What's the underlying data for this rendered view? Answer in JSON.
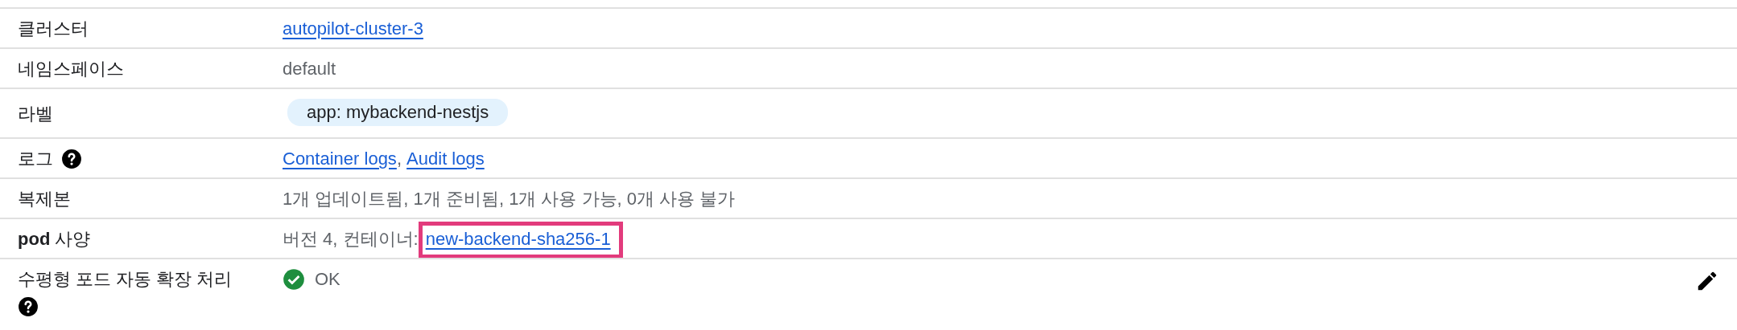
{
  "rows": [
    {
      "label": "클러스터",
      "help": false,
      "editable": false,
      "parts": [
        {
          "kind": "link",
          "text": "autopilot-cluster-3",
          "highlighted": false
        }
      ]
    },
    {
      "label": "네임스페이스",
      "help": false,
      "editable": false,
      "parts": [
        {
          "kind": "text",
          "text": "default"
        }
      ]
    },
    {
      "label": "라벨",
      "help": false,
      "editable": false,
      "parts": [
        {
          "kind": "chip",
          "text": "app: mybackend-nestjs"
        }
      ]
    },
    {
      "label": "로그",
      "help": true,
      "editable": false,
      "parts": [
        {
          "kind": "link",
          "text": "Container logs",
          "highlighted": false
        },
        {
          "kind": "text",
          "text": ", "
        },
        {
          "kind": "link",
          "text": "Audit logs",
          "highlighted": false
        }
      ]
    },
    {
      "label": "복제본",
      "help": false,
      "editable": false,
      "parts": [
        {
          "kind": "text",
          "text": "1개 업데이트됨, 1개 준비됨, 1개 사용 가능, 0개 사용 불가"
        }
      ]
    },
    {
      "label": "**pod** 사양",
      "help": false,
      "editable": false,
      "parts": [
        {
          "kind": "text",
          "text": "버전 4, 컨테이너:"
        },
        {
          "kind": "link",
          "text": "new-backend-sha256-1",
          "highlighted": true
        }
      ]
    },
    {
      "label": "수평형 포드 자동 확장 처리",
      "help": true,
      "editable": true,
      "parts": [
        {
          "kind": "ok-status",
          "text": "OK"
        }
      ]
    }
  ]
}
